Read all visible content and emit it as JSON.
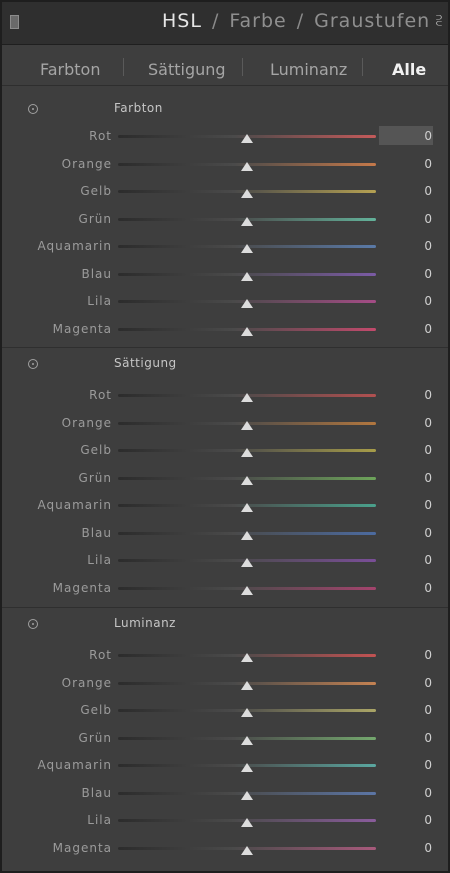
{
  "header": {
    "title_hsl": "HSL",
    "sep1": "/",
    "title_farbe": "Farbe",
    "sep2": "/",
    "title_graustufen": "Graustufen",
    "menu_icon": "menu-arrow-icon"
  },
  "tabs": [
    {
      "label": "Farbton",
      "active": false
    },
    {
      "label": "Sättigung",
      "active": false
    },
    {
      "label": "Luminanz",
      "active": false
    },
    {
      "label": "Alle",
      "active": true
    }
  ],
  "sections": [
    {
      "title": "Farbton",
      "rows": [
        {
          "label": "Rot",
          "value": "0",
          "track": "#c45a5a",
          "slider_level": 0.5
        },
        {
          "label": "Orange",
          "value": "0",
          "track": "#c5794a",
          "slider_level": 0.5
        },
        {
          "label": "Gelb",
          "value": "0",
          "track": "#b5a152",
          "slider_level": 0.5
        },
        {
          "label": "Grün",
          "value": "0",
          "track": "#63b29a",
          "slider_level": 0.5
        },
        {
          "label": "Aquamarin",
          "value": "0",
          "track": "#5a7aa8",
          "slider_level": 0.5
        },
        {
          "label": "Blau",
          "value": "0",
          "track": "#7b5ba5",
          "slider_level": 0.5
        },
        {
          "label": "Lila",
          "value": "0",
          "track": "#a54c86",
          "slider_level": 0.5
        },
        {
          "label": "Magenta",
          "value": "0",
          "track": "#c24a6c",
          "slider_level": 0.5
        }
      ]
    },
    {
      "title": "Sättigung",
      "rows": [
        {
          "label": "Rot",
          "value": "0",
          "track": "#b15050",
          "slider_level": 0.5
        },
        {
          "label": "Orange",
          "value": "0",
          "track": "#b2773f",
          "slider_level": 0.5
        },
        {
          "label": "Gelb",
          "value": "0",
          "track": "#a79d49",
          "slider_level": 0.5
        },
        {
          "label": "Grün",
          "value": "0",
          "track": "#6da45a",
          "slider_level": 0.5
        },
        {
          "label": "Aquamarin",
          "value": "0",
          "track": "#4aa18c",
          "slider_level": 0.5
        },
        {
          "label": "Blau",
          "value": "0",
          "track": "#4c6ba0",
          "slider_level": 0.5
        },
        {
          "label": "Lila",
          "value": "0",
          "track": "#7a4e98",
          "slider_level": 0.5
        },
        {
          "label": "Magenta",
          "value": "0",
          "track": "#a4446d",
          "slider_level": 0.5
        }
      ]
    },
    {
      "title": "Luminanz",
      "rows": [
        {
          "label": "Rot",
          "value": "0",
          "track": "#c25252",
          "slider_level": 0.5
        },
        {
          "label": "Orange",
          "value": "0",
          "track": "#c48252",
          "slider_level": 0.5
        },
        {
          "label": "Gelb",
          "value": "0",
          "track": "#aba667",
          "slider_level": 0.5
        },
        {
          "label": "Grün",
          "value": "0",
          "track": "#74a86e",
          "slider_level": 0.5
        },
        {
          "label": "Aquamarin",
          "value": "0",
          "track": "#5aa7a0",
          "slider_level": 0.5
        },
        {
          "label": "Blau",
          "value": "0",
          "track": "#5c76a6",
          "slider_level": 0.5
        },
        {
          "label": "Lila",
          "value": "0",
          "track": "#8a5c9c",
          "slider_level": 0.5
        },
        {
          "label": "Magenta",
          "value": "0",
          "track": "#a85a7c",
          "slider_level": 0.5
        }
      ]
    }
  ]
}
